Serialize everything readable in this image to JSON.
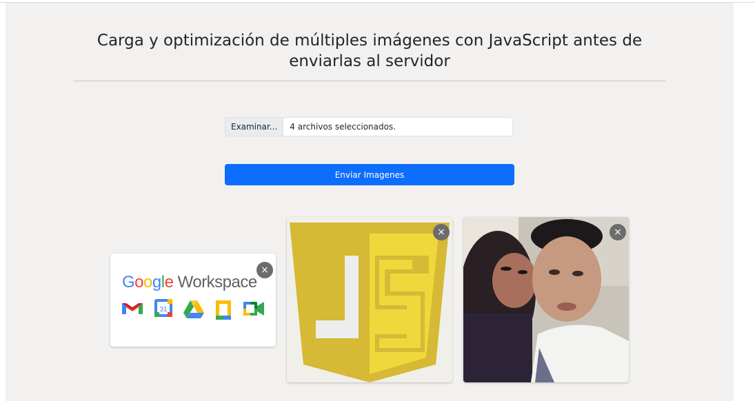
{
  "page": {
    "title": "Carga y optimización de múltiples imágenes con JavaScript antes de enviarlas al servidor"
  },
  "file_input": {
    "button_label": "Examinar...",
    "status_text": "4 archivos seleccionados."
  },
  "submit": {
    "label": "Enviar Imagenes"
  },
  "previews": [
    {
      "name": "Google Workspace",
      "close_label": "×",
      "logo": {
        "g1": "G",
        "o1": "o",
        "o2": "o",
        "g2": "g",
        "l": "l",
        "e": "e",
        "word": "Workspace"
      }
    },
    {
      "name": "JavaScript logo",
      "close_label": "×"
    },
    {
      "name": "photo",
      "close_label": "×"
    }
  ],
  "colors": {
    "background": "#f2f1f0",
    "primary": "#0d6efd",
    "js_yellow": "#f0d83c",
    "js_dark": "#d6b934"
  }
}
